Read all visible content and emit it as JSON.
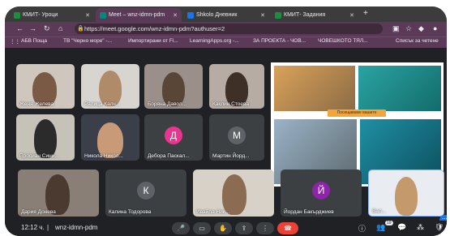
{
  "tabs": [
    {
      "label": "КМИТ- Уроци",
      "active": false,
      "color": "#1e8e3e"
    },
    {
      "label": "Meet – wnz-idmn-pdm",
      "active": true,
      "color": "#00897b"
    },
    {
      "label": "Shkolo Дневник",
      "active": false,
      "color": "#1a73e8"
    },
    {
      "label": "КМИТ- Задания",
      "active": false,
      "color": "#1e8e3e"
    }
  ],
  "address": {
    "url": "https://meet.google.com/wnz-idmn-pdm?authuser=2"
  },
  "bookmarks": [
    "АБВ Поща",
    "ТВ \"Черно море\" -...",
    "Импортирани от Fi...",
    "LearningApps.org -...",
    "ЗА ПРОЕКТА - ЧОВ...",
    "ЧОВЕШКОТО ТЯЛ...",
    "Списък за четене"
  ],
  "participants": [
    {
      "name": "Женя Желева"
    },
    {
      "name": "Ралица Калч..."
    },
    {
      "name": "Боряна Давол..."
    },
    {
      "name": "Каклин Стоева"
    },
    {
      "name": "Просиан Сини..."
    },
    {
      "name": "Никола Никол..."
    },
    {
      "name": "Дебора Паскал...",
      "initial": "Д",
      "color": "#e8368f"
    },
    {
      "name": "Мартин Йорд...",
      "initial": "М",
      "color": "#5f6368"
    },
    {
      "name": "Дария Донева"
    },
    {
      "name": "Калина Тодорова",
      "initial": "К",
      "color": "#5f6368"
    },
    {
      "name": "Ивайла Ник..."
    },
    {
      "name": "Йордан Бакърджиев",
      "initial": "Й",
      "color": "#8e24aa"
    },
    {
      "name": "Вал..."
    }
  ],
  "presentation": {
    "caption": "Посещаваме вашите"
  },
  "bottom": {
    "time": "12:12 ч.",
    "separator": "|",
    "meeting_code": "wnz-idmn-pdm",
    "participant_count": "19"
  }
}
